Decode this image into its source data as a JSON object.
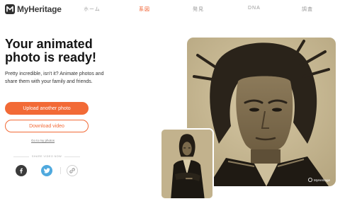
{
  "brand": {
    "name": "MyHeritage"
  },
  "nav": {
    "items": [
      {
        "label": "ホーム",
        "active": false
      },
      {
        "label": "系図",
        "active": true
      },
      {
        "label": "発見",
        "active": false
      },
      {
        "label": "DNA",
        "active": false
      },
      {
        "label": "調査",
        "active": false
      }
    ]
  },
  "main": {
    "headline": "Your animated photo is ready!",
    "description": "Pretty incredible, isn't it? Animate photos and share them with your family and friends.",
    "upload_button": "Upload another photo",
    "download_button": "Download video",
    "photos_link": "Go to my photos",
    "share_label": "SHARE VIDEO NOW"
  },
  "photo": {
    "watermark": "MyHeritage"
  },
  "colors": {
    "accent": "#f26a36",
    "twitter": "#4fa9de",
    "facebook": "#3b3b3b",
    "sepia": "#c9b994"
  },
  "icons": [
    "myheritage-logo-icon",
    "facebook-icon",
    "twitter-icon",
    "link-icon"
  ]
}
